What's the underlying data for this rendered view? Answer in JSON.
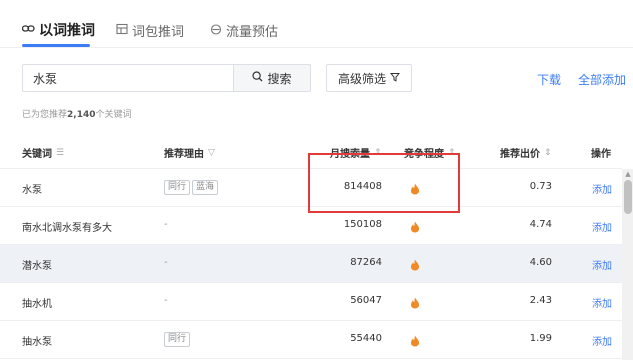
{
  "tabs": [
    {
      "label": "以词推词",
      "icon": "link-icon",
      "active": true
    },
    {
      "label": "词包推词",
      "icon": "package-icon",
      "active": false
    },
    {
      "label": "流量预估",
      "icon": "gauge-icon",
      "active": false
    }
  ],
  "search": {
    "value": "水泵",
    "button_label": "搜索"
  },
  "filter": {
    "label": "高级筛选"
  },
  "actions": {
    "download": "下载",
    "add_all": "全部添加"
  },
  "summary": {
    "prefix": "已为您推荐",
    "count": "2,140",
    "suffix": "个关键词"
  },
  "table": {
    "headers": {
      "keyword": "关键词",
      "reason": "推荐理由",
      "monthly_search": "月搜索量",
      "competition": "竞争程度",
      "bid": "推荐出价",
      "action": "操作"
    },
    "rows": [
      {
        "keyword": "水泵",
        "tags": [
          "同行",
          "蓝海"
        ],
        "reason": "",
        "monthly_search": "814408",
        "bid": "0.73",
        "action": "添加"
      },
      {
        "keyword": "南水北调水泵有多大",
        "tags": [],
        "reason": "-",
        "monthly_search": "150108",
        "bid": "4.74",
        "action": "添加"
      },
      {
        "keyword": "潜水泵",
        "tags": [],
        "reason": "-",
        "monthly_search": "87264",
        "bid": "4.60",
        "action": "添加"
      },
      {
        "keyword": "抽水机",
        "tags": [],
        "reason": "-",
        "monthly_search": "56047",
        "bid": "2.43",
        "action": "添加"
      },
      {
        "keyword": "抽水泵",
        "tags": [
          "同行"
        ],
        "reason": "",
        "monthly_search": "55440",
        "bid": "1.99",
        "action": "添加"
      }
    ]
  },
  "colors": {
    "accent": "#3d7cf5",
    "fire": "#f08a24",
    "highlight_box": "#e03a3a"
  }
}
